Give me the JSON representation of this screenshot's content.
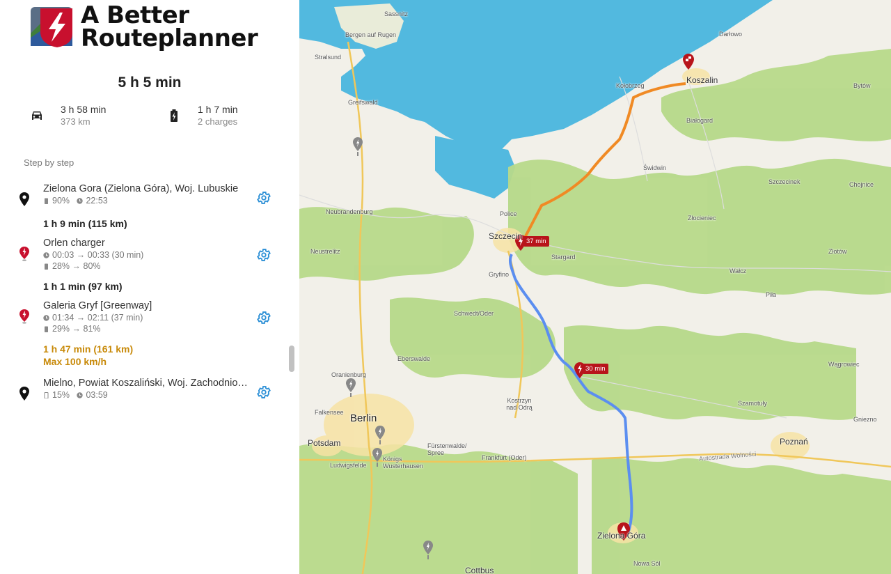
{
  "brand": {
    "line1": "A Better",
    "line2": "Routeplanner"
  },
  "summary": {
    "total": "5 h 5 min",
    "drive_time": "3 h 58 min",
    "drive_distance": "373 km",
    "charge_time": "1 h 7 min",
    "charge_count": "2 charges",
    "drive_icon": "car-icon",
    "charge_icon": "battery-charging-icon"
  },
  "steps_heading": "Step by step",
  "steps": [
    {
      "title": "Zielona Gora (Zielona Góra), Woj. Lubuskie",
      "soc": "90%",
      "time": "22:53",
      "pin": "location-pin-icon"
    },
    {
      "title": "Orlen charger",
      "time_range": "00:03",
      "time_to": "00:33 (30 min)",
      "soc_from": "28%",
      "soc_to": "80%",
      "pin": "charger-pin-icon"
    },
    {
      "title": "Galeria Gryf [Greenway]",
      "time_range": "01:34",
      "time_to": "02:11 (37 min)",
      "soc_from": "29%",
      "soc_to": "81%",
      "pin": "charger-pin-icon"
    },
    {
      "title": "Mielno, Powiat Koszaliński, Woj. Zachodniopomorskie",
      "soc": "15%",
      "time": "03:59",
      "pin": "location-pin-icon"
    }
  ],
  "legs": [
    {
      "text": "1 h 9 min (115 km)"
    },
    {
      "text": "1 h 1 min (97 km)"
    },
    {
      "text": "1 h 47 min (161 km)",
      "text2": "Max 100 km/h"
    }
  ],
  "arrow": "→",
  "map": {
    "badges": [
      "37 min",
      "30 min"
    ],
    "places": {
      "sassnitz": "Sassnitz",
      "bergen": "Bergen auf Rugen",
      "stralsund": "Stralsund",
      "greifswald": "Greifswald",
      "darlowo": "Darłowo",
      "koszalin": "Koszalin",
      "kolobrzeg": "Kołobrzeg",
      "bytow": "Bytów",
      "bialogard": "Białogard",
      "swidwin": "Świdwin",
      "szczecinek": "Szczecinek",
      "chojnice": "Chojnice",
      "neubrandenburg": "Neubrandenburg",
      "police": "Police",
      "szczecin": "Szczecin",
      "zlocieniec": "Złocieniec",
      "neustrelitz": "Neustrelitz",
      "stargard": "Stargard",
      "zlotow": "Złotów",
      "gryfino": "Gryfino",
      "walcz": "Wałcz",
      "pila": "Piła",
      "schwedt": "Schwedt/Oder",
      "eberswalde": "Eberswalde",
      "wagrowiec": "Wągrowiec",
      "oranienburg": "Oranienburg",
      "kostrzyn": "Kostrzyn nad Odrą",
      "szamotuly": "Szamotuły",
      "falkensee": "Falkensee",
      "berlin": "Berlin",
      "gniezno": "Gniezno",
      "potsdam": "Potsdam",
      "poznan": "Poznań",
      "furstenwalde": "Fürstenwalde/ Spree",
      "ludwigsfelde": "Ludwigsfelde",
      "konigs": "Königs Wusterhausen",
      "frankfurt": "Frankfurt (Oder)",
      "autostrada": "Autostrada Wolności",
      "zielona": "Zielona Góra",
      "nowasol": "Nowa Sól",
      "cottbus": "Cottbus"
    }
  },
  "colors": {
    "brand_red": "#c8102e",
    "gear_blue": "#2b8fd6",
    "warn_orange": "#c88a0a",
    "route_blue": "#5b8ef0",
    "route_orange": "#f08a24",
    "sea": "#52b9df",
    "forest": "#b7d98a"
  }
}
